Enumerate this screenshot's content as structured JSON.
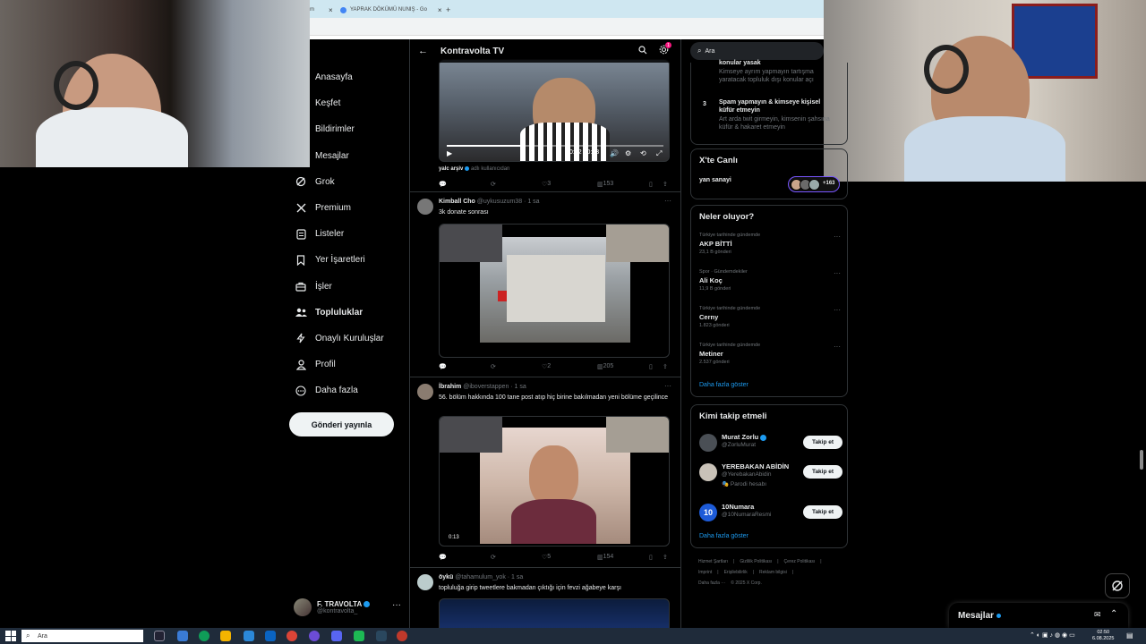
{
  "browser": {
    "tab1": "m",
    "tab2": "YAPRAK DÖKÜMÜ NUNIŞ - Go",
    "close": "×",
    "new_tab": "+"
  },
  "nav": {
    "items": [
      {
        "label": "Anasayfa",
        "icon": "home-icon"
      },
      {
        "label": "Keşfet",
        "icon": "search-icon"
      },
      {
        "label": "Bildirimler",
        "icon": "bell-icon"
      },
      {
        "label": "Mesajlar",
        "icon": "mail-icon"
      },
      {
        "label": "Grok",
        "icon": "grok-icon"
      },
      {
        "label": "Premium",
        "icon": "x-logo-icon"
      },
      {
        "label": "Listeler",
        "icon": "list-icon"
      },
      {
        "label": "Yer İşaretleri",
        "icon": "bookmark-icon"
      },
      {
        "label": "İşler",
        "icon": "briefcase-icon"
      },
      {
        "label": "Topluluklar",
        "icon": "people-icon"
      },
      {
        "label": "Onaylı Kuruluşlar",
        "icon": "lightning-icon"
      },
      {
        "label": "Profil",
        "icon": "person-icon"
      },
      {
        "label": "Daha fazla",
        "icon": "more-circle-icon"
      }
    ],
    "post_button": "Gönderi yayınla",
    "account_name": "F. TRAVOLTA",
    "account_handle": "@kontravolta_",
    "more": "···"
  },
  "header": {
    "back": "←",
    "title": "Kontravolta TV",
    "badge": "1"
  },
  "tweets": {
    "t0": {
      "video_time": "0:12 / 0:33",
      "progress": 0.36,
      "source_name": "yalc arşiv",
      "source_suffix": "adlı kullanıcıdan",
      "replies": "",
      "retweets": "",
      "likes": "3",
      "views": "153"
    },
    "t1": {
      "name": "Kimball Cho",
      "meta": "@uykusuzum38 · 1 sa",
      "text": "3k donate sonrası",
      "likes": "2",
      "views": "205"
    },
    "t2": {
      "name": "İbrahim",
      "meta": "@iboverstappen · 1 sa",
      "text": "56. bölüm hakkında 100 tane post atıp hiç birine bakılmadan yeni bölüme geçilince",
      "video_time": "0:13",
      "likes": "5",
      "views": "154"
    },
    "t3": {
      "name": "öykü",
      "meta": "@tahamulum_yok · 1 sa",
      "text": "topluluğa girip tweetlere bakmadan çıktığı için fevzi ağabeye karşı"
    }
  },
  "right": {
    "search_placeholder": "Ara",
    "rules": {
      "partial_title": "konular yasak",
      "partial_desc": "Kimseye ayrım yapmayın tartışma yaratacak topluluk dışı konular açı",
      "item3_num": "3",
      "item3_title": "Spam yapmayın & kimseye kişisel küfür etmeyin",
      "item3_desc": "Art arda twit girmeyin, kimsenin şahsına küfür & hakaret etmeyin"
    },
    "live": {
      "title": "X'te Canlı",
      "host": "yan sanayi",
      "count": "+163"
    },
    "trends": {
      "title": "Neler oluyor?",
      "items": [
        {
          "cat": "Türkiye tarihinde gündemde",
          "title": "AKP BİTTİ",
          "count": "23,1 B gönderi"
        },
        {
          "cat": "Spor · Gündemdekiler",
          "title": "Ali Koç",
          "count": "11,9 B gönderi"
        },
        {
          "cat": "Türkiye tarihinde gündemde",
          "title": "Cerny",
          "count": "1.823 gönderi"
        },
        {
          "cat": "Türkiye tarihinde gündemde",
          "title": "Metiner",
          "count": "2.537 gönderi"
        }
      ],
      "show_more": "Daha fazla göster"
    },
    "follow": {
      "title": "Kimi takip etmeli",
      "items": [
        {
          "name": "Murat Zorlu",
          "handle": "@ZorluMurat",
          "extra": "",
          "button": "Takip et"
        },
        {
          "name": "YEREBAKAN ABİDİN",
          "handle": "@YerebakanAbidin",
          "extra": "Parodi hesabı",
          "button": "Takip et"
        },
        {
          "name": "10Numara",
          "handle": "@10NumaraResmi",
          "extra": "",
          "button": "Takip et"
        }
      ],
      "show_more": "Daha fazla göster"
    },
    "footer": {
      "l1": "Hizmet Şartları",
      "l2": "Gizlilik Politikası",
      "l3": "Çerez Politikası",
      "l4": "Imprint",
      "l5": "Erişilebilirlik",
      "l6": "Reklam bilgisi",
      "l7": "Daha fazla ···",
      "l8": "© 2025 X Corp."
    }
  },
  "messages": {
    "label": "Mesajlar"
  },
  "taskbar": {
    "search": "Ara",
    "time": "02:50",
    "date": "6.08.2025"
  }
}
